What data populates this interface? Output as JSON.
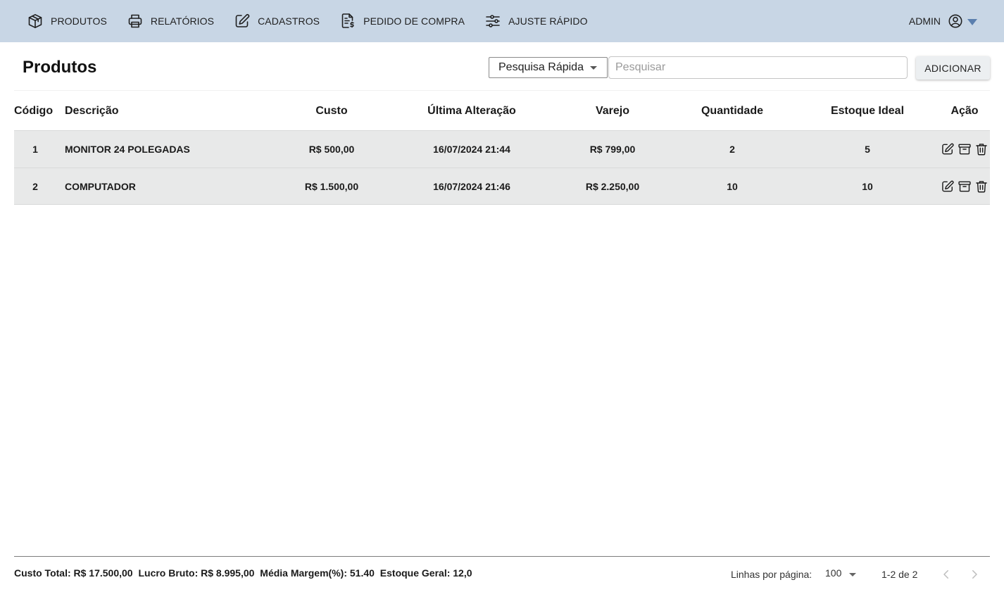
{
  "nav": {
    "items": [
      {
        "label": "PRODUTOS",
        "icon": "package-icon"
      },
      {
        "label": "RELATÓRIOS",
        "icon": "printer-icon"
      },
      {
        "label": "CADASTROS",
        "icon": "edit-icon"
      },
      {
        "label": "PEDIDO DE COMPRA",
        "icon": "invoice-icon"
      },
      {
        "label": "AJUSTE RÁPIDO",
        "icon": "sliders-icon"
      }
    ],
    "user": "ADMIN",
    "accent": "#5b7fae",
    "bar_color": "#c8d6e5"
  },
  "page": {
    "title": "Produtos",
    "search_mode": "Pesquisa Rápida",
    "search_placeholder": "Pesquisar",
    "search_value": "",
    "add_label": "ADICIONAR"
  },
  "table": {
    "columns": [
      "Código",
      "Descrição",
      "Custo",
      "Última Alteração",
      "Varejo",
      "Quantidade",
      "Estoque Ideal",
      "Ação"
    ],
    "rows": [
      {
        "codigo": "1",
        "descricao": "MONITOR 24 POLEGADAS",
        "custo": "R$ 500,00",
        "alteracao": "16/07/2024 21:44",
        "varejo": "R$ 799,00",
        "quantidade": "2",
        "estoque": "5"
      },
      {
        "codigo": "2",
        "descricao": "COMPUTADOR",
        "custo": "R$ 1.500,00",
        "alteracao": "16/07/2024 21:46",
        "varejo": "R$ 2.250,00",
        "quantidade": "10",
        "estoque": "10"
      }
    ],
    "row_color": "#e8e9e9"
  },
  "footer": {
    "custo_total": "Custo Total: R$ 17.500,00",
    "lucro_bruto": "Lucro Bruto: R$ 8.995,00",
    "media_margem": "Média Margem(%): 51.40",
    "estoque_geral": "Estoque Geral: 12,0",
    "rows_label": "Linhas por página:",
    "rows_value": "100",
    "range": "1-2 de 2"
  }
}
